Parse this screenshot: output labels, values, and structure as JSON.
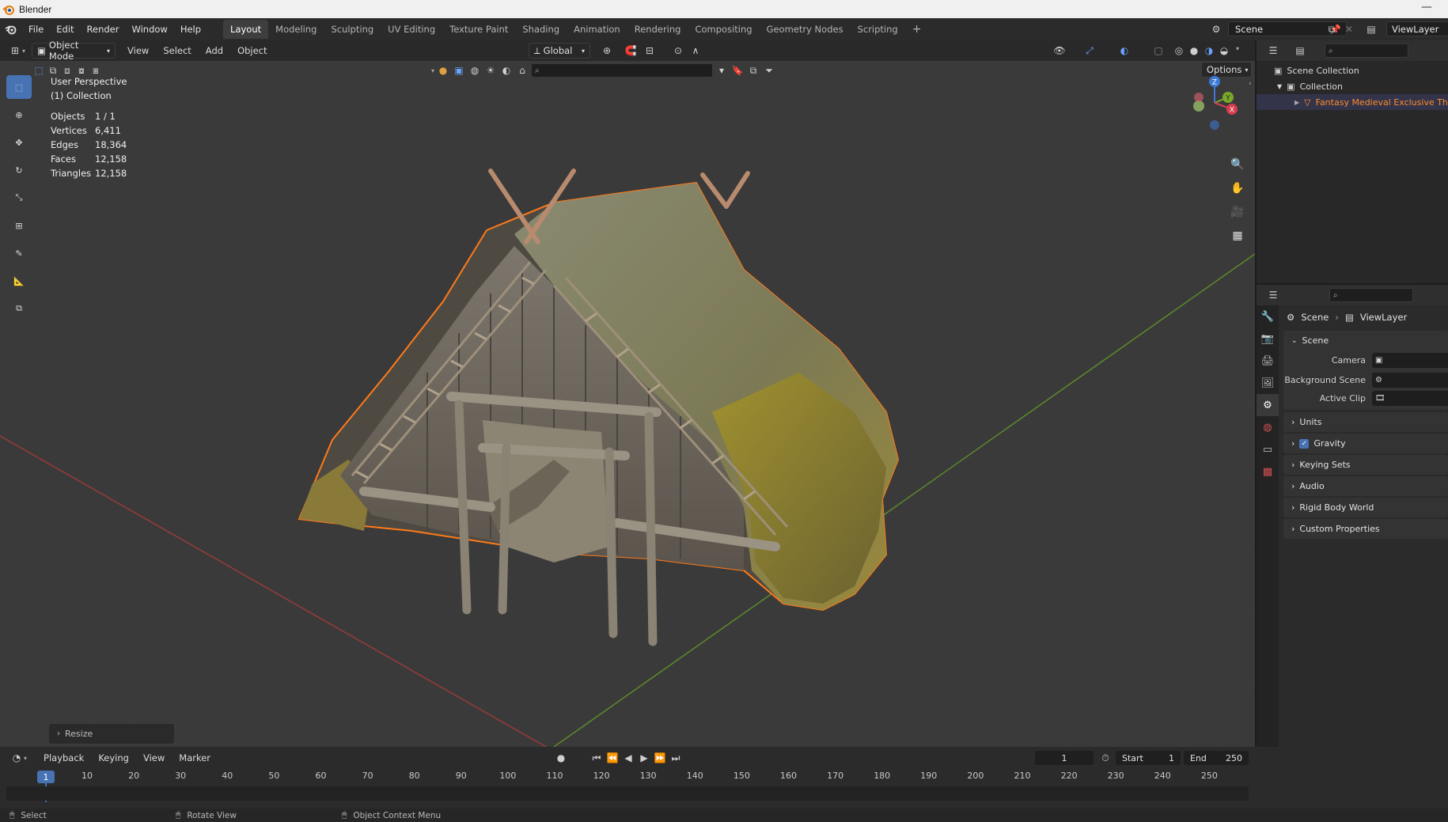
{
  "window": {
    "title": "Blender",
    "minimize_glyph": "—"
  },
  "menu": {
    "items": [
      "File",
      "Edit",
      "Render",
      "Window",
      "Help"
    ]
  },
  "workspaces": {
    "tabs": [
      "Layout",
      "Modeling",
      "Sculpting",
      "UV Editing",
      "Texture Paint",
      "Shading",
      "Animation",
      "Rendering",
      "Compositing",
      "Geometry Nodes",
      "Scripting"
    ],
    "active": "Layout",
    "add_glyph": "+"
  },
  "topright": {
    "scene": "Scene",
    "view_layer": "ViewLayer"
  },
  "viewport_header": {
    "mode": "Object Mode",
    "menus": [
      "View",
      "Select",
      "Add",
      "Object"
    ],
    "transform_orientation": "Global",
    "options_label": "Options"
  },
  "viewport_overlay": {
    "perspective": "User Perspective",
    "collection": "(1) Collection",
    "stats": [
      {
        "k": "Objects",
        "v": "1 / 1"
      },
      {
        "k": "Vertices",
        "v": "6,411"
      },
      {
        "k": "Edges",
        "v": "18,364"
      },
      {
        "k": "Faces",
        "v": "12,158"
      },
      {
        "k": "Triangles",
        "v": "12,158"
      }
    ]
  },
  "gizmo": {
    "z": "Z",
    "y": "Y",
    "x": "X"
  },
  "resize_panel": {
    "label": "Resize"
  },
  "outliner": {
    "root": "Scene Collection",
    "collection": "Collection",
    "object": "Fantasy Medieval Exclusive Tha"
  },
  "properties": {
    "breadcrumb": {
      "scene": "Scene",
      "view_layer": "ViewLayer"
    },
    "scene_panel": {
      "title": "Scene",
      "camera_label": "Camera",
      "background_scene_label": "Background Scene",
      "active_clip_label": "Active Clip"
    },
    "collapsed_panels": [
      "Units",
      "Gravity",
      "Keying Sets",
      "Audio",
      "Rigid Body World",
      "Custom Properties"
    ],
    "gravity_checked": true
  },
  "timeline": {
    "menus": [
      "Playback",
      "Keying",
      "View",
      "Marker"
    ],
    "current_frame": "1",
    "start_label": "Start",
    "start_value": "1",
    "end_label": "End",
    "end_value": "250",
    "playhead": "1",
    "ticks": [
      "10",
      "20",
      "30",
      "40",
      "50",
      "60",
      "70",
      "80",
      "90",
      "100",
      "110",
      "120",
      "130",
      "140",
      "150",
      "160",
      "170",
      "180",
      "190",
      "200",
      "210",
      "220",
      "230",
      "240",
      "250"
    ]
  },
  "statusbar": {
    "select": "Select",
    "rotate": "Rotate View",
    "context": "Object Context Menu"
  },
  "colors": {
    "accent": "#4772b3",
    "selection_outline": "#ff7a1a",
    "viewport_bg": "#3a3a3a"
  }
}
